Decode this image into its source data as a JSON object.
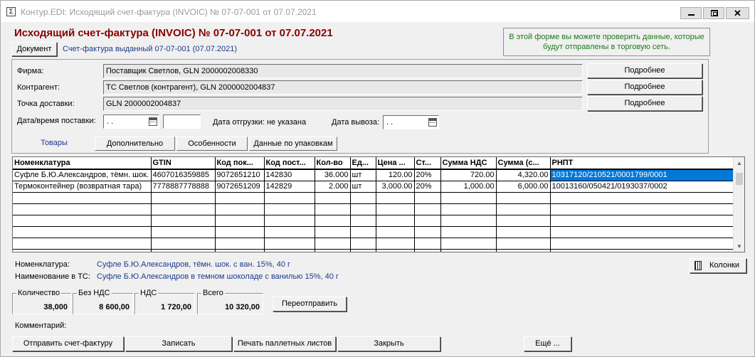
{
  "window": {
    "title": "Контур.EDI: Исходящий счет-фактура (INVOIC) № 07-07-001 от 07.07.2021"
  },
  "header": {
    "heading": "Исходящий счет-фактура (INVOIC) № 07-07-001 от 07.07.2021",
    "document_button": "Документ",
    "subtitle": "Счет-фактура выданный 07-07-001 (07.07.2021)",
    "info": "В этой форме вы можете проверить данные, которые будут отправлены в торговую сеть."
  },
  "fields": {
    "firm_label": "Фирма:",
    "firm_value": "Поставщик Светлов, GLN 2000002008330",
    "counterparty_label": "Контрагент:",
    "counterparty_value": "ТС Светлов (контрагент), GLN 2000002004837",
    "delivery_point_label": "Точка доставки:",
    "delivery_point_value": "GLN 2000002004837",
    "more_button": "Подробнее",
    "delivery_datetime_label": "Дата/время поставки:",
    "delivery_date_value": " . .",
    "shipment_date_text": "Дата отгрузки: не указана",
    "export_date_label": "Дата вывоза:",
    "export_date_value": " . ."
  },
  "tabs": [
    "Товары",
    "Дополнительно",
    "Особенности",
    "Данные по упаковкам"
  ],
  "grid": {
    "columns": [
      "Номенклатура",
      "GTIN",
      "Код пок...",
      "Код пост...",
      "Кол-во",
      "Ед...",
      "Цена ...",
      "Ст...",
      "Сумма НДС",
      "Сумма (с...",
      "РНПТ"
    ],
    "rows": [
      [
        "Суфле Б.Ю.Александров, тёмн. шок.",
        "4607016359885",
        "9072651210",
        "142830",
        "36.000",
        "шт",
        "120.00",
        "20%",
        "720.00",
        "4,320.00",
        "10317120/210521/0001799/0001"
      ],
      [
        "Термоконтейнер (возвратная тара)",
        "7778887778888",
        "9072651209",
        "142829",
        "2.000",
        "шт",
        "3,000.00",
        "20%",
        "1,000.00",
        "6,000.00",
        "10013160/050421/0193037/0002"
      ]
    ],
    "empty_rows": 6
  },
  "details": {
    "nomenclature_label": "Номенклатура:",
    "nomenclature_value": "Суфле Б.Ю.Александров, тёмн. шок. с ван. 15%, 40 г",
    "ts_name_label": "Наименование в ТС:",
    "ts_name_value": "Суфле Б.Ю.Александров в темном шоколаде с ванилью 15%, 40 г",
    "columns_button": "Колонки"
  },
  "totals": {
    "quantity_label": "Количество",
    "quantity_value": "38,000",
    "no_vat_label": "Без НДС",
    "no_vat_value": "8 600,00",
    "vat_label": "НДС",
    "vat_value": "1 720,00",
    "total_label": "Всего",
    "total_value": "10 320,00",
    "resend_button": "Переотправить"
  },
  "comment_label": "Комментарий:",
  "actions": {
    "send": "Отправить счет-фактуру",
    "save": "Записать",
    "print_pallet": "Печать паллетных листов",
    "close": "Закрыть",
    "more": "Ещё ..."
  },
  "colors": {
    "heading": "#8b0000",
    "info_text": "#1a7a1a",
    "link_blue": "#1c3a8a",
    "selection": "#0078d7"
  }
}
